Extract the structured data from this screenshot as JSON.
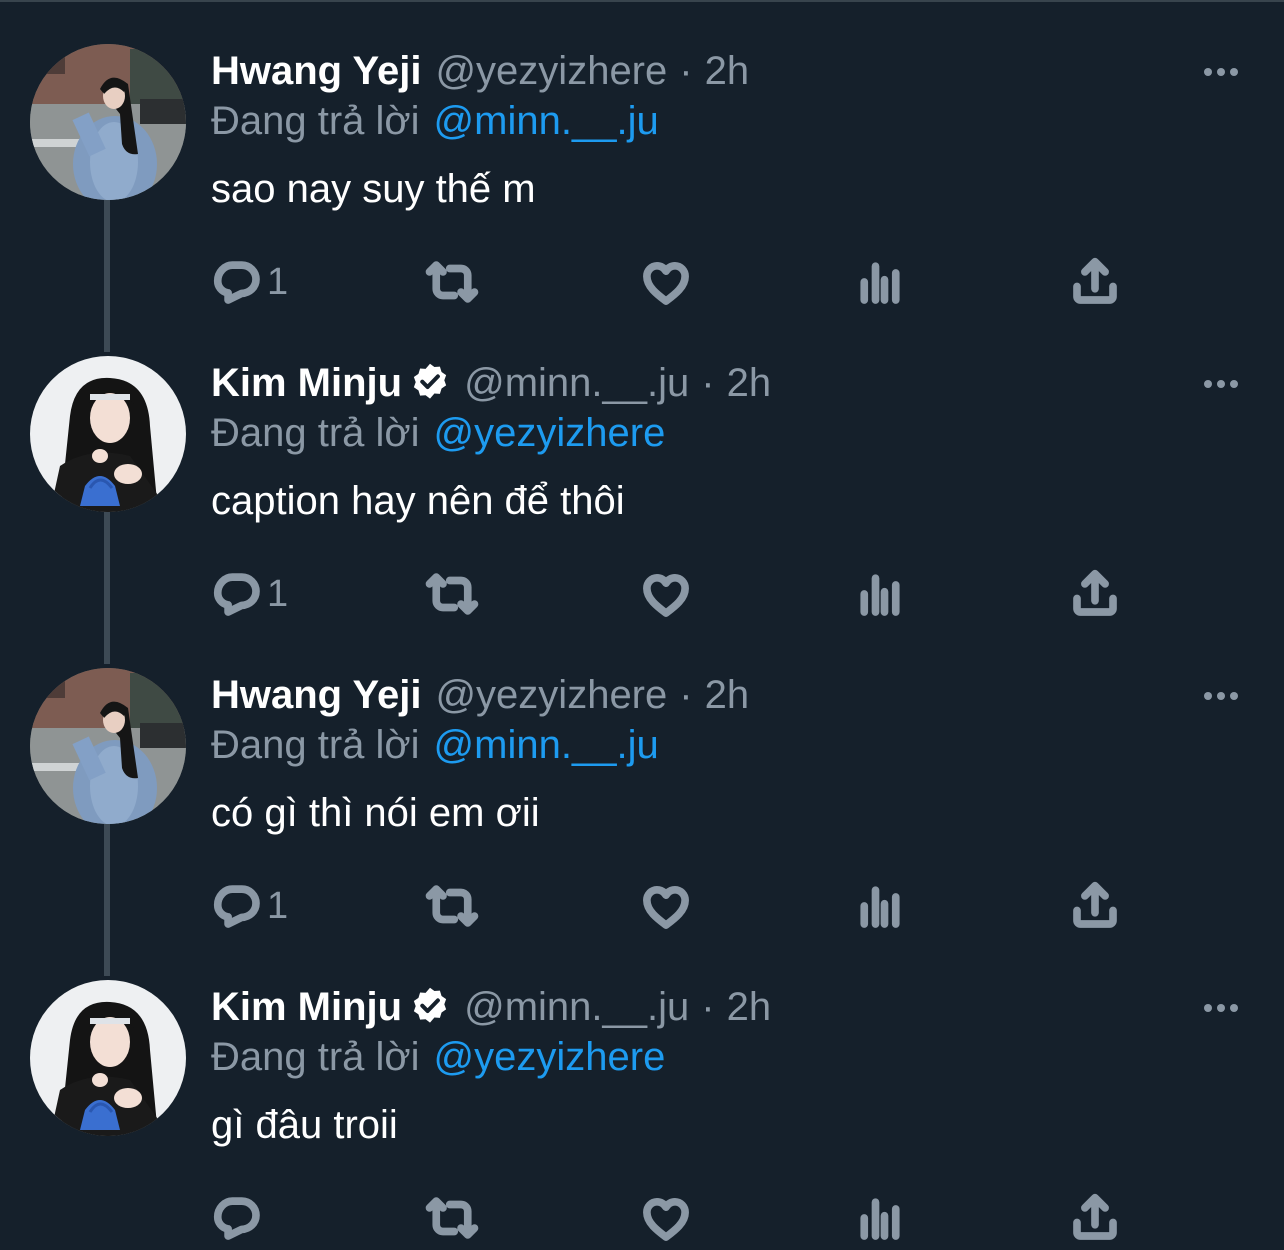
{
  "tweets": [
    {
      "name": "Hwang Yeji",
      "verified": false,
      "handle": "@yezyizhere",
      "sep": "·",
      "time": "2h",
      "reply_prefix": "Đang trả lời",
      "reply_to": "@minn.__.ju",
      "text": "sao nay suy thế m",
      "reply_count": "1",
      "avatar": "yeji-avatar"
    },
    {
      "name": "Kim Minju",
      "verified": true,
      "handle": "@minn.__.ju",
      "sep": "·",
      "time": "2h",
      "reply_prefix": "Đang trả lời",
      "reply_to": "@yezyizhere",
      "text": "caption hay nên để thôi",
      "reply_count": "1",
      "avatar": "minju-avatar"
    },
    {
      "name": "Hwang Yeji",
      "verified": false,
      "handle": "@yezyizhere",
      "sep": "·",
      "time": "2h",
      "reply_prefix": "Đang trả lời",
      "reply_to": "@minn.__.ju",
      "text": "có gì thì nói em ơii",
      "reply_count": "1",
      "avatar": "yeji-avatar"
    },
    {
      "name": "Kim Minju",
      "verified": true,
      "handle": "@minn.__.ju",
      "sep": "·",
      "time": "2h",
      "reply_prefix": "Đang trả lời",
      "reply_to": "@yezyizhere",
      "text": "gì đâu troii",
      "reply_count": "",
      "avatar": "minju-avatar"
    }
  ],
  "colors": {
    "background": "#15202b",
    "text": "#ffffff",
    "muted": "#8b98a5",
    "accent": "#1d9bf0",
    "thread_line": "#3d4a55"
  },
  "icons": [
    "reply-icon",
    "retweet-icon",
    "like-icon",
    "views-icon",
    "share-icon",
    "more-icon",
    "verified-icon"
  ]
}
